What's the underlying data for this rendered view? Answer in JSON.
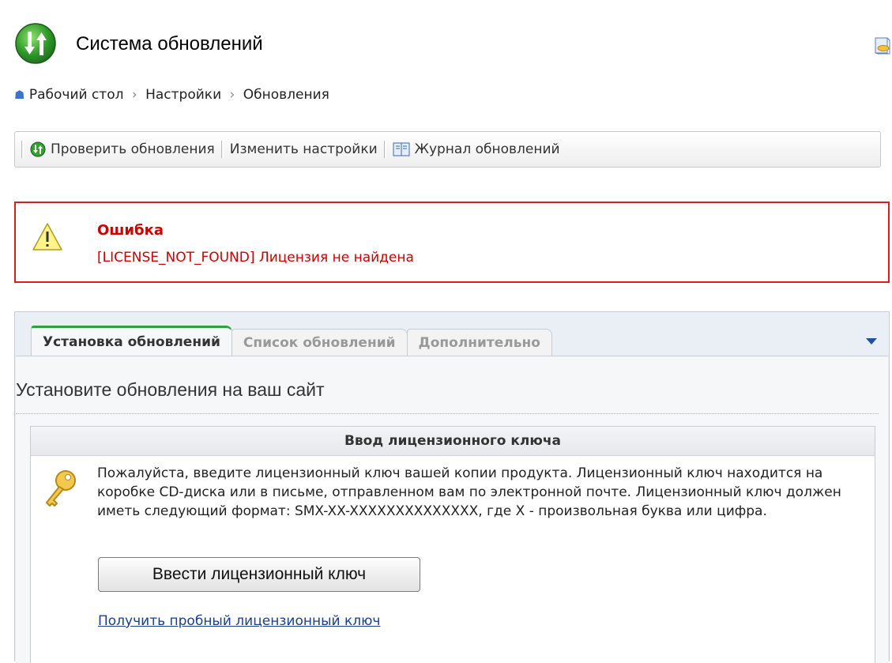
{
  "header": {
    "title": "Система обновлений",
    "logo_icon": "update-logo-icon",
    "help_icon": "help-book-icon"
  },
  "breadcrumb": {
    "items": [
      "Рабочий стол",
      "Настройки",
      "Обновления"
    ],
    "separator": "›"
  },
  "toolbar": {
    "check_label": "Проверить обновления",
    "settings_label": "Изменить настройки",
    "log_label": "Журнал обновлений"
  },
  "error": {
    "title": "Ошибка",
    "message": "[LICENSE_NOT_FOUND] Лицензия не найдена",
    "color": "#cc0000"
  },
  "tabs": {
    "items": [
      "Установка обновлений",
      "Список обновлений",
      "Дополнительно"
    ],
    "active": "Установка обновлений"
  },
  "content": {
    "title": "Установите обновления на ваш сайт",
    "license_box": {
      "header": "Ввод лицензионного ключа",
      "text": "Пожалуйста, введите лицензионный ключ вашей копии продукта. Лицензионный ключ находится на коробке CD-диска или в письме, отправленном вам по электронной почте. Лицензионный ключ должен иметь следующий формат: SMX-XX-XXXXXXXXXXXXXX, где X - произвольная буква или цифра.",
      "button_label": "Ввести лицензионный ключ",
      "trial_link": "Получить пробный лицензионный ключ"
    }
  },
  "colors": {
    "accent_green": "#2ea040",
    "error_red": "#d32020",
    "link_blue": "#1a3f8a"
  }
}
